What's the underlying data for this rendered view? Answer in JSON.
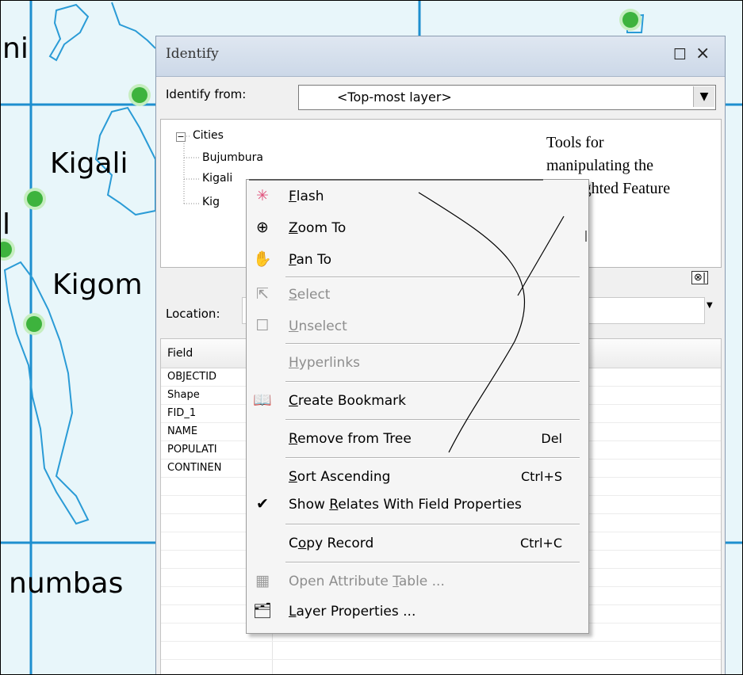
{
  "map": {
    "labels": [
      "ni",
      "Kigali",
      "Kigom",
      "numbas",
      "l"
    ]
  },
  "identify": {
    "title": "Identify",
    "maximize_glyph": "☐",
    "close_glyph": "×",
    "from_label": "Identify from:",
    "from_value": "<Top-most layer>",
    "from_arrow": "▼",
    "tree": {
      "expander": "−",
      "root": "Cities",
      "children": [
        "Bujumbura",
        "Kigali",
        "Kig"
      ]
    },
    "split_icons": "⊗|",
    "location_label": "Location:",
    "grid": {
      "header": "Field",
      "rows": [
        "OBJECTID",
        "Shape",
        "FID_1",
        "NAME",
        "POPULATI",
        "CONTINEN"
      ]
    }
  },
  "annotation": {
    "lines": [
      "Tools for",
      "manipulating the",
      "highlighted Feature"
    ]
  },
  "context_menu": {
    "items": [
      {
        "pre": "",
        "u": "F",
        "post": "lash",
        "icon": "flash-icon",
        "glyph": "✳",
        "enabled": true,
        "shortcut": ""
      },
      {
        "pre": "",
        "u": "Z",
        "post": "oom To",
        "icon": "zoom-to-icon",
        "glyph": "⊕",
        "enabled": true,
        "shortcut": ""
      },
      {
        "pre": "",
        "u": "P",
        "post": "an To",
        "icon": "pan-hand-icon",
        "glyph": "✋",
        "enabled": true,
        "shortcut": ""
      },
      {
        "pre": "",
        "u": "S",
        "post": "elect",
        "icon": "select-arrow-icon",
        "glyph": "⇱",
        "enabled": false,
        "shortcut": ""
      },
      {
        "pre": "",
        "u": "U",
        "post": "nselect",
        "icon": "unselect-icon",
        "glyph": "☐",
        "enabled": false,
        "shortcut": ""
      },
      {
        "pre": "",
        "u": "H",
        "post": "yperlinks",
        "icon": "",
        "glyph": "",
        "enabled": false,
        "shortcut": ""
      },
      {
        "pre": "",
        "u": "C",
        "post": "reate Bookmark",
        "icon": "bookmark-icon",
        "glyph": "📖",
        "enabled": true,
        "shortcut": ""
      },
      {
        "pre": "",
        "u": "R",
        "post": "emove from Tree",
        "icon": "",
        "glyph": "",
        "enabled": true,
        "shortcut": "Del"
      },
      {
        "pre": "",
        "u": "S",
        "post": "ort Ascending",
        "icon": "",
        "glyph": "",
        "enabled": true,
        "shortcut": "Ctrl+S"
      },
      {
        "pre": "Show ",
        "u": "R",
        "post": "elates With Field Properties",
        "icon": "checkmark-icon",
        "glyph": "✔",
        "enabled": true,
        "shortcut": ""
      },
      {
        "pre": "C",
        "u": "o",
        "post": "py Record",
        "icon": "",
        "glyph": "",
        "enabled": true,
        "shortcut": "Ctrl+C"
      },
      {
        "pre": "Open Attribute ",
        "u": "T",
        "post": "able ...",
        "icon": "table-icon",
        "glyph": "▦",
        "enabled": false,
        "shortcut": ""
      },
      {
        "pre": "",
        "u": "L",
        "post": "ayer Properties ...",
        "icon": "layer-properties-icon",
        "glyph": "🗂",
        "enabled": true,
        "shortcut": ""
      }
    ]
  },
  "colors": {
    "map_water": "#e8f6fa",
    "grid_line": "#1e8fcf",
    "river": "#2a9bd6",
    "city": "#3db33d"
  }
}
